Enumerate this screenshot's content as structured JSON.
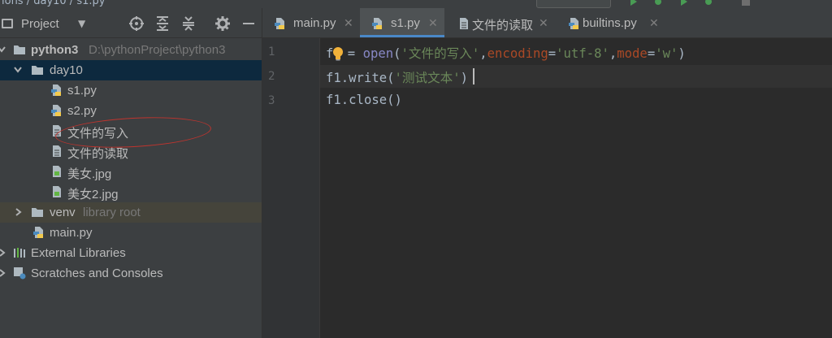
{
  "colors": {
    "editor_bg": "#2b2b2b",
    "panel_bg": "#3c3f41",
    "selection_bg": "#0d293e",
    "excluded_bg": "#45443b",
    "tab_underline": "#4a88c7",
    "string": "#6a8759",
    "builtin": "#8888c6",
    "keyword_arg": "#aa4926",
    "annotation": "#c0342e"
  },
  "titlebar": {
    "breadcrumb": "ions / day10 / s1.py"
  },
  "panel": {
    "title": "Project",
    "dropdown_icon": "chevron-down-icon",
    "tools": [
      "locate-icon",
      "expand-all-icon",
      "collapse-all-icon",
      "gear-icon",
      "hide-icon"
    ]
  },
  "tree": {
    "root": {
      "label": "python3",
      "hint": "D:\\pythonProject\\python3"
    },
    "folder": {
      "label": "day10"
    },
    "files": [
      {
        "label": "s1.py",
        "icon": "python-file-icon"
      },
      {
        "label": "s2.py",
        "icon": "python-file-icon"
      },
      {
        "label": "文件的写入",
        "icon": "text-file-icon"
      },
      {
        "label": "文件的读取",
        "icon": "text-file-icon"
      },
      {
        "label": "美女.jpg",
        "icon": "image-file-icon"
      },
      {
        "label": "美女2.jpg",
        "icon": "image-file-icon"
      }
    ],
    "venv": {
      "label": "venv",
      "hint": "library root"
    },
    "main": {
      "label": "main.py"
    },
    "external": {
      "label": "External Libraries"
    },
    "scratches": {
      "label": "Scratches and Consoles"
    }
  },
  "tabs": [
    {
      "label": "main.py",
      "icon": "python-file-icon",
      "active": false
    },
    {
      "label": "s1.py",
      "icon": "python-file-icon",
      "active": true
    },
    {
      "label": "文件的读取",
      "icon": "text-file-icon",
      "active": false
    },
    {
      "label": "builtins.py",
      "icon": "python-file-icon",
      "active": false
    }
  ],
  "gutter": {
    "lines": [
      "1",
      "2",
      "3"
    ]
  },
  "code": {
    "line1": {
      "var": "f",
      "eq": " = ",
      "fn": "open",
      "p1": "(",
      "s1": "'文件的写入'",
      "c1": ",",
      "k1": "encoding",
      "e1": "=",
      "s2": "'utf-8'",
      "c2": ",",
      "k2": "mode",
      "e2": "=",
      "s3": "'w'",
      "p2": ")"
    },
    "line2": {
      "obj": "f1.write(",
      "s1": "'测试文本",
      "s2": "'",
      "end": ")"
    },
    "line3": {
      "text": "f1.close()"
    }
  }
}
